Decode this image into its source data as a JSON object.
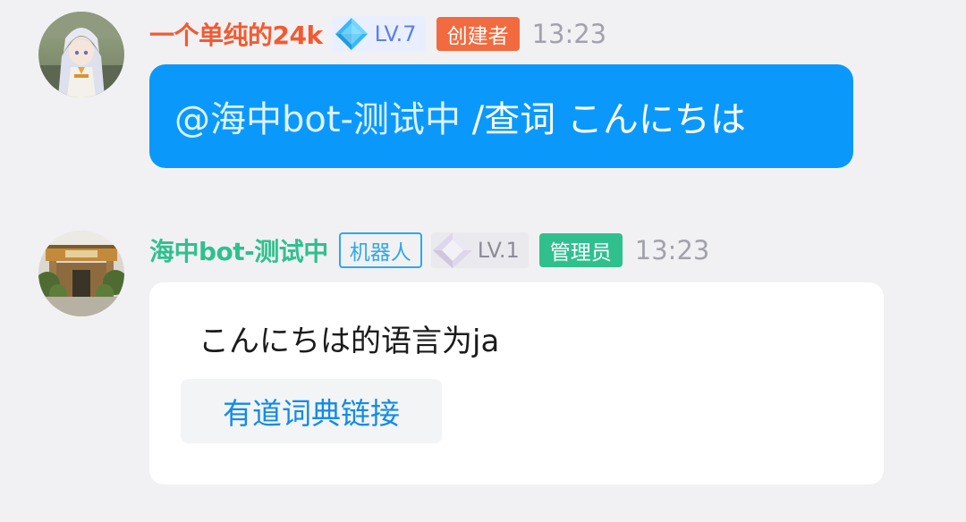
{
  "messages": [
    {
      "sender": "一个单纯的24k",
      "name_color": "#f35a32",
      "level": "LV.7",
      "role": "创建者",
      "role_color": "#f26a3f",
      "time": "13:23",
      "mention": "@海中bot-测试中",
      "content": " /查词 こんにちは",
      "bubble_color": "#0a99fb"
    },
    {
      "sender": "海中bot-测试中",
      "name_color": "#2fc08e",
      "bot_tag": "机器人",
      "level": "LV.1",
      "role": "管理员",
      "role_color": "#2fc08e",
      "time": "13:23",
      "content": "こんにちは的语言为ja",
      "link_label": "有道词典链接",
      "link_color": "#138be6"
    }
  ]
}
